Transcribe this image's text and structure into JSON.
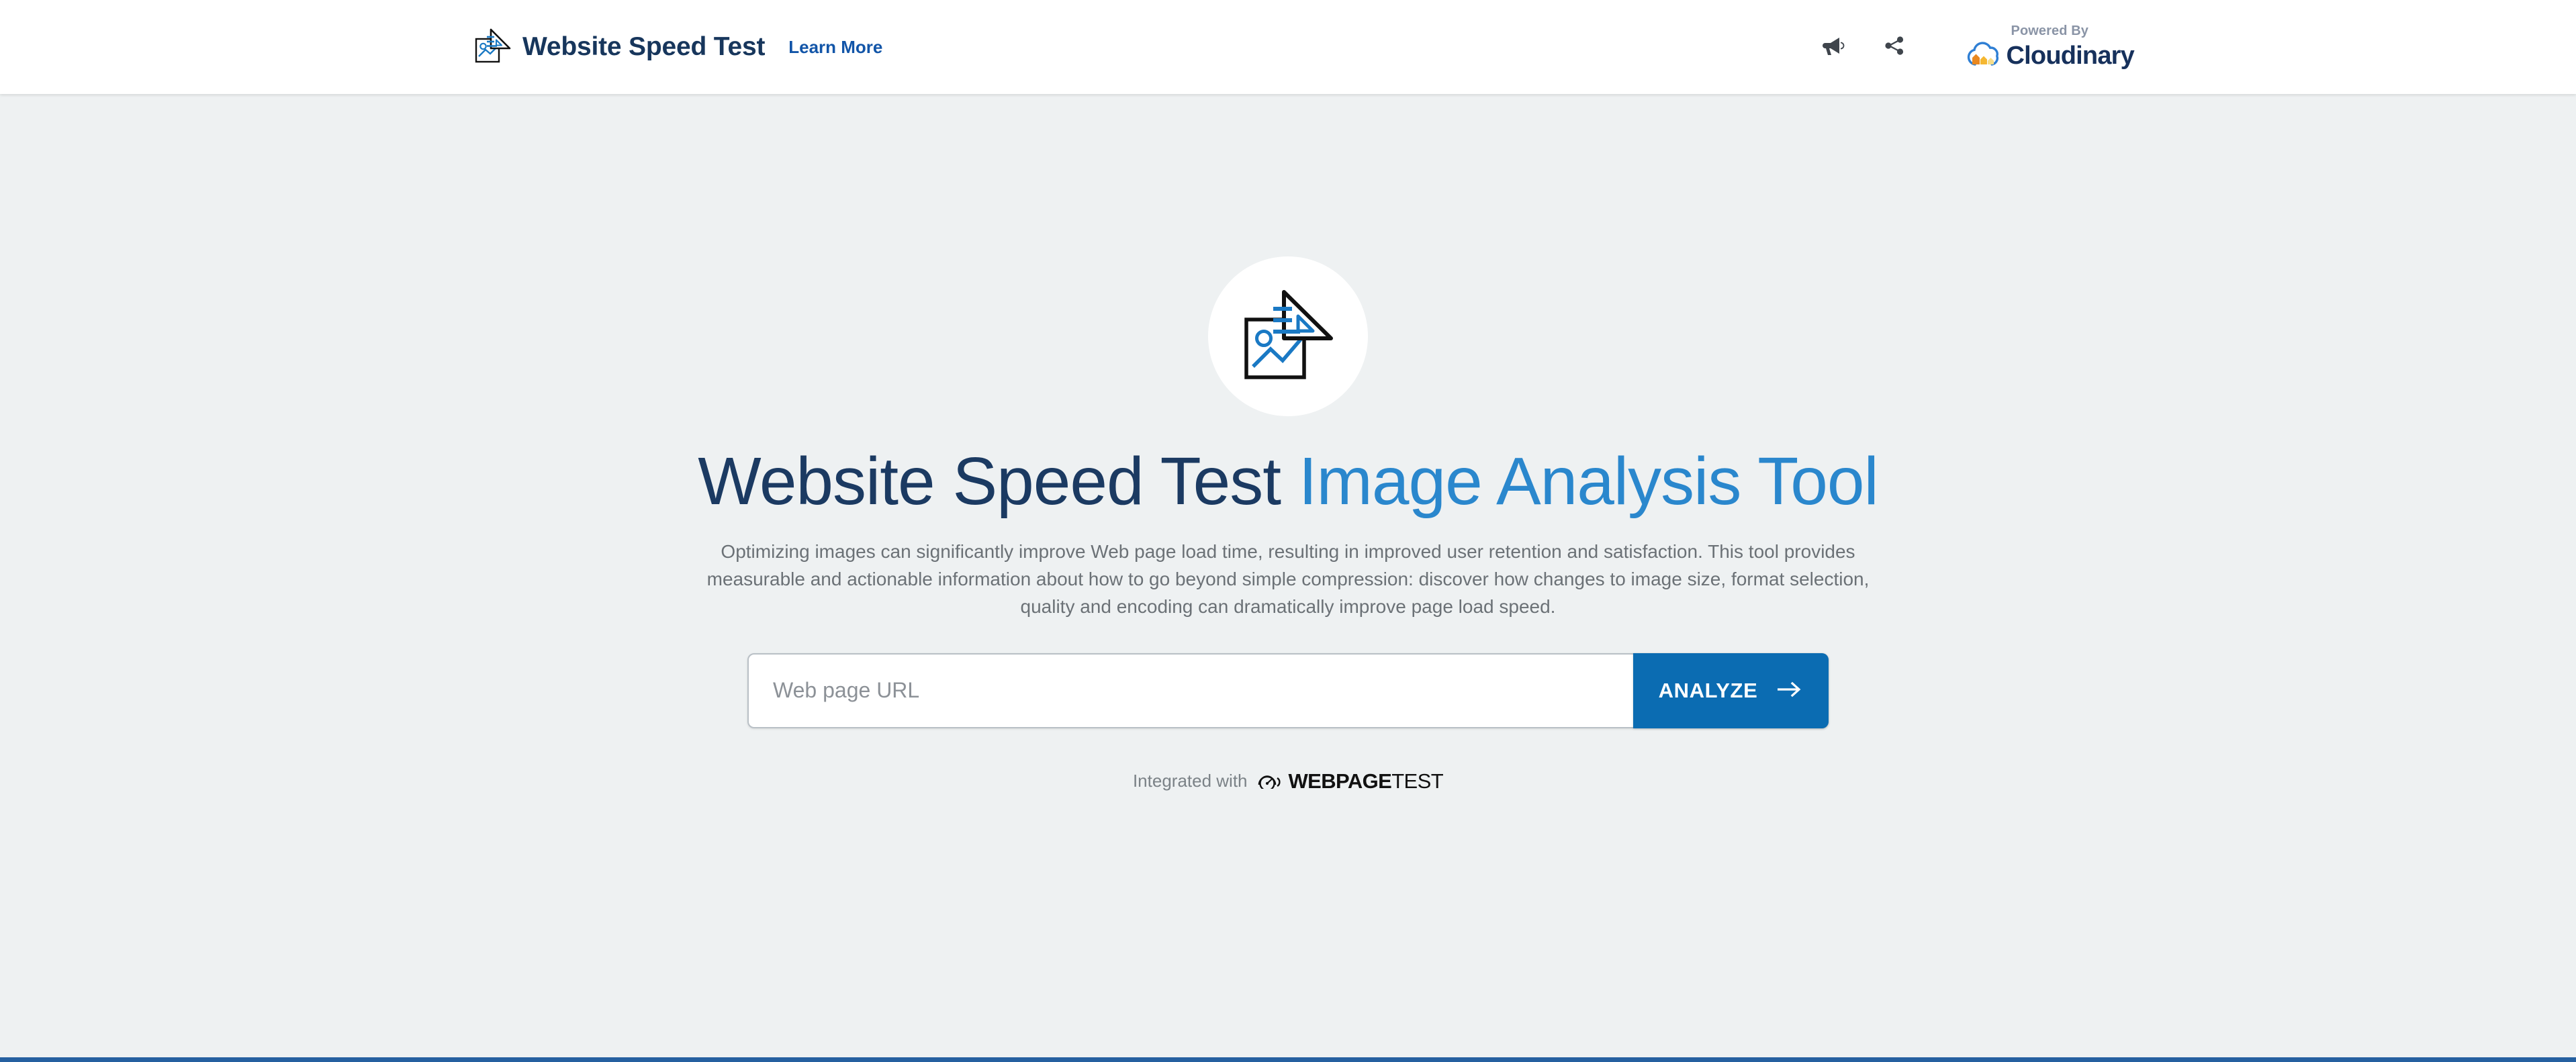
{
  "header": {
    "logo_icon": "image-analysis-logo-icon",
    "title": "Website Speed Test",
    "learn_more_label": "Learn More",
    "megaphone_icon": "megaphone-icon",
    "share_icon": "share-icon",
    "powered_by_label": "Powered By",
    "brand_name": "Cloudinary",
    "brand_icon": "cloudinary-cloud-bars-icon"
  },
  "hero": {
    "logo_icon": "image-analysis-logo-icon",
    "title_part_dark": "Website Speed Test",
    "title_part_light": " Image Analysis Tool",
    "description": "Optimizing images can significantly improve Web page load time, resulting in improved user retention and satisfaction. This tool provides measurable and actionable information about how to go beyond simple compression: discover how changes to image size, format selection, quality and encoding can dramatically improve page load speed."
  },
  "search": {
    "placeholder": "Web page URL",
    "value": "",
    "analyze_label": "ANALYZE",
    "arrow_icon": "arrow-right-icon"
  },
  "footer": {
    "integrated_label": "Integrated with",
    "partner_name_bold": "WEBPAGE",
    "partner_name_regular": "TEST",
    "partner_icon": "speedometer-gauge-icon"
  },
  "colors": {
    "page_background": "#eef1f2",
    "header_background": "#ffffff",
    "brand_dark_navy": "#17365c",
    "link_blue": "#1255a8",
    "title_light_blue": "#2a87cd",
    "accent_blue": "#0b6cb2",
    "bottom_bar_blue": "#2560a0",
    "body_text_gray": "#6b7176",
    "icon_dark": "#3f454c",
    "cloudinary_bar_dark_orange": "#e98820",
    "cloudinary_bar_mid_orange": "#f5b731",
    "cloudinary_bar_light_yellow": "#f7dd8a",
    "cloudinary_cloud_blue": "#2f7fd4"
  }
}
